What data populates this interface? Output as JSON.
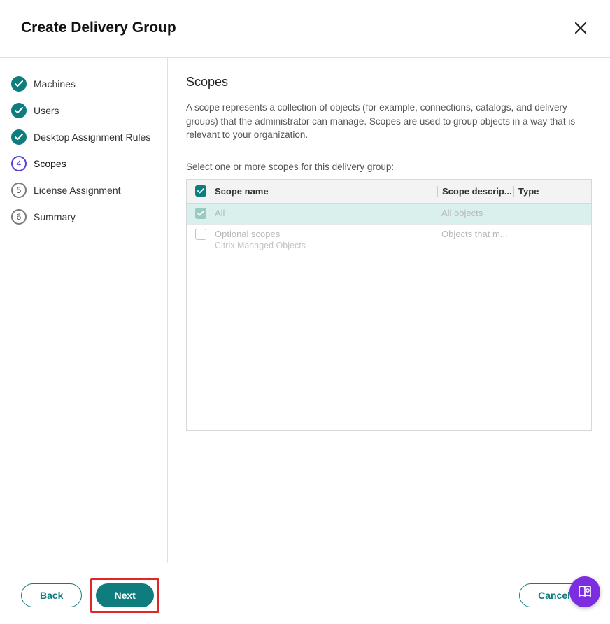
{
  "header": {
    "title": "Create Delivery Group"
  },
  "steps": [
    {
      "label": "Machines",
      "state": "done"
    },
    {
      "label": "Users",
      "state": "done"
    },
    {
      "label": "Desktop Assignment Rules",
      "state": "done"
    },
    {
      "label": "Scopes",
      "state": "current",
      "num": "4"
    },
    {
      "label": "License Assignment",
      "state": "pending",
      "num": "5"
    },
    {
      "label": "Summary",
      "state": "pending",
      "num": "6"
    }
  ],
  "main": {
    "heading": "Scopes",
    "description": "A scope represents a collection of objects (for example, connections, catalogs, and delivery groups) that the administrator can manage. Scopes are used to group objects in a way that is relevant to your organization.",
    "instruction": "Select one or more scopes for this delivery group:",
    "table": {
      "columns": {
        "name": "Scope name",
        "desc": "Scope descrip...",
        "type": "Type"
      },
      "rows": [
        {
          "checked": true,
          "disabled": true,
          "selected": true,
          "name": "All",
          "sub": "",
          "desc": "All objects",
          "type": ""
        },
        {
          "checked": false,
          "disabled": true,
          "selected": false,
          "name": "Optional scopes",
          "sub": "Citrix Managed Objects",
          "desc": "Objects that m...",
          "type": ""
        }
      ]
    }
  },
  "footer": {
    "back": "Back",
    "next": "Next",
    "cancel": "Cancel"
  }
}
